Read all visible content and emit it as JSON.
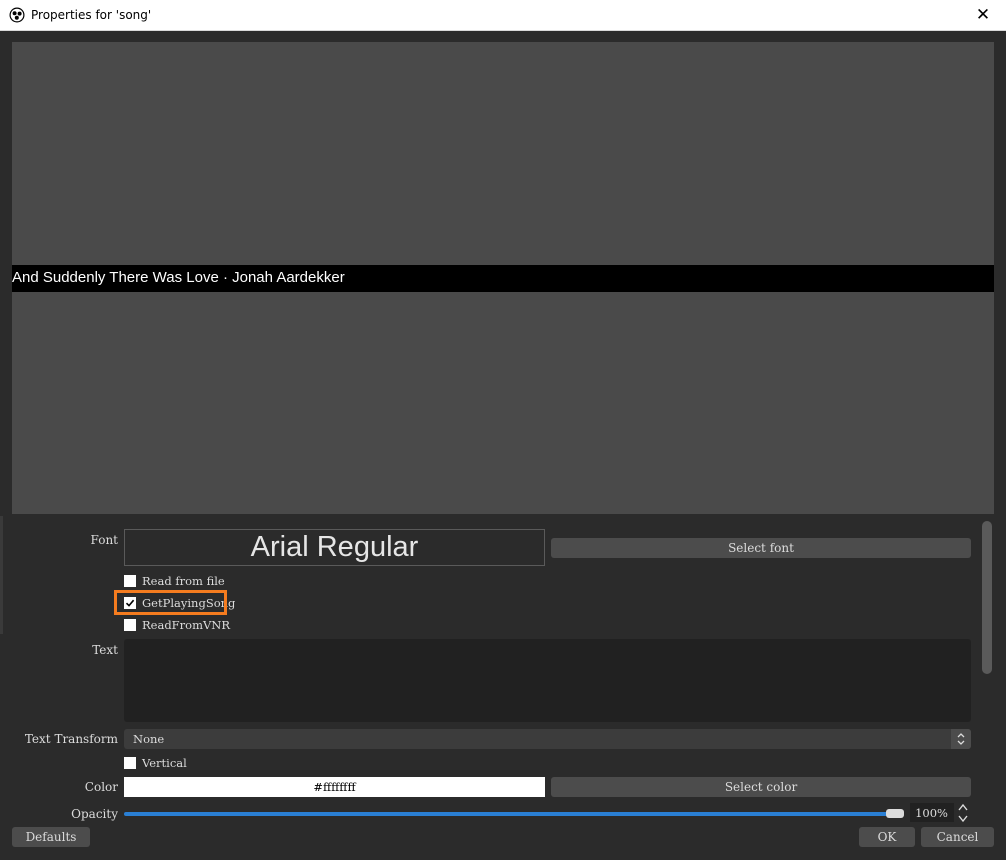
{
  "window": {
    "title": "Properties for 'song'",
    "close_glyph": "✕",
    "icon": "obs-logo-icon"
  },
  "preview": {
    "text": "And Suddenly There Was Love · Jonah Aardekker"
  },
  "properties": {
    "font_label": "Font",
    "font_value": "Arial Regular",
    "select_font_label": "Select font",
    "checkboxes": [
      {
        "label": "Read from file",
        "checked": false
      },
      {
        "label": "GetPlayingSong",
        "checked": true
      },
      {
        "label": "ReadFromVNR",
        "checked": false
      }
    ],
    "text_label": "Text",
    "text_value": "",
    "transform_label": "Text Transform",
    "transform_value": "None",
    "vertical_label": "Vertical",
    "vertical_checked": false,
    "color_label": "Color",
    "color_value": "#ffffffff",
    "select_color_label": "Select color",
    "opacity_label": "Opacity",
    "opacity_value": "100%",
    "opacity_fraction": 1.0
  },
  "footer": {
    "defaults_label": "Defaults",
    "ok_label": "OK",
    "cancel_label": "Cancel"
  },
  "colors": {
    "accent": "#2a7fd4",
    "highlight": "#f57c1f",
    "background": "#2b2b2b",
    "preview_bg": "#4a4a4a"
  }
}
